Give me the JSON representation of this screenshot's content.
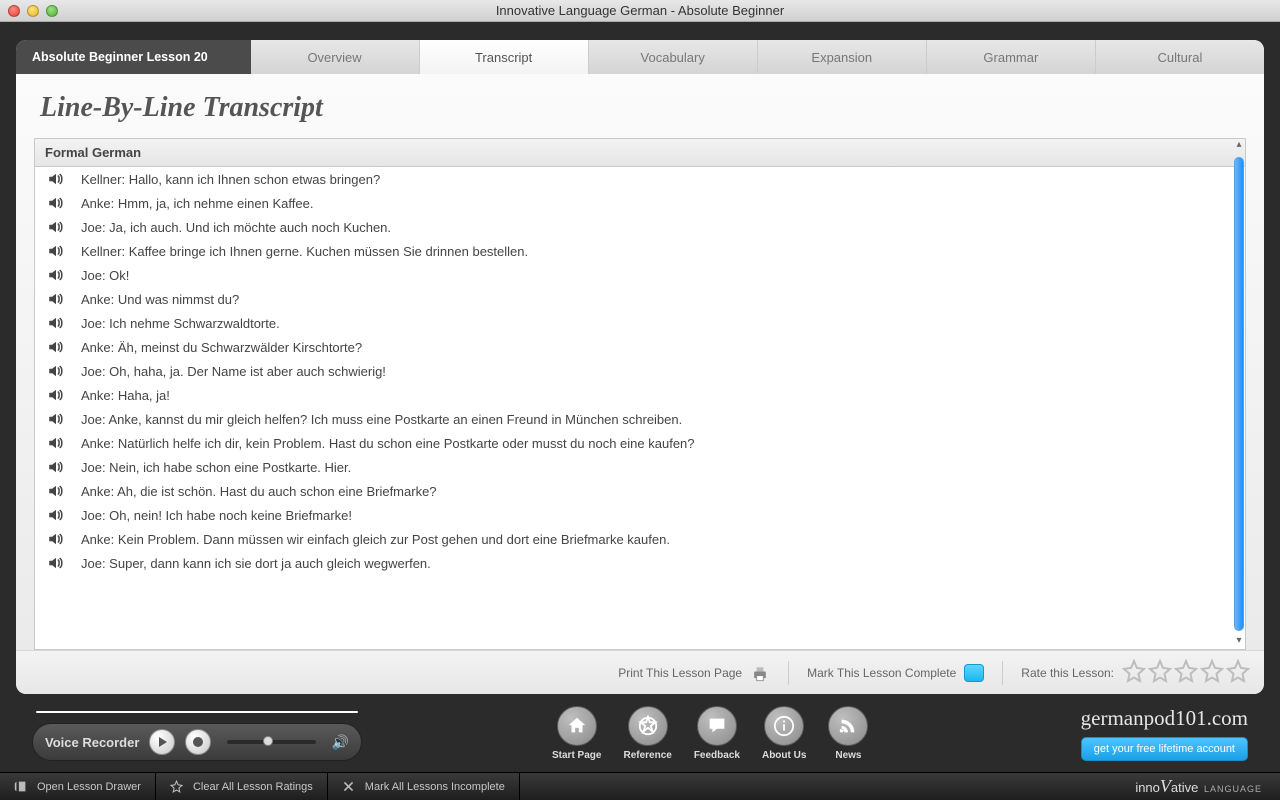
{
  "window": {
    "title": "Innovative Language German - Absolute Beginner"
  },
  "tabs": {
    "lesson": "Absolute Beginner Lesson 20",
    "items": [
      "Overview",
      "Transcript",
      "Vocabulary",
      "Expansion",
      "Grammar",
      "Cultural"
    ],
    "active_index": 1
  },
  "heading": "Line-By-Line Transcript",
  "transcript": {
    "section_title": "Formal German",
    "lines": [
      "Kellner: Hallo, kann ich Ihnen schon etwas bringen?",
      "Anke: Hmm, ja, ich nehme einen Kaffee.",
      "Joe: Ja, ich auch. Und ich möchte auch noch Kuchen.",
      "Kellner: Kaffee bringe ich Ihnen gerne. Kuchen müssen Sie drinnen bestellen.",
      "Joe: Ok!",
      "Anke: Und was nimmst du?",
      "Joe: Ich nehme Schwarzwaldtorte.",
      "Anke: Äh, meinst du Schwarzwälder Kirschtorte?",
      "Joe: Oh, haha, ja. Der Name ist aber auch schwierig!",
      "Anke: Haha, ja!",
      "Joe: Anke, kannst du mir gleich helfen? Ich muss eine Postkarte an einen Freund in München schreiben.",
      "Anke: Natürlich helfe ich dir, kein Problem. Hast du schon eine Postkarte oder musst du noch eine kaufen?",
      "Joe: Nein, ich habe schon eine Postkarte. Hier.",
      "Anke: Ah, die ist schön. Hast du auch schon eine Briefmarke?",
      "Joe: Oh, nein! Ich habe noch keine Briefmarke!",
      "Anke: Kein Problem. Dann müssen wir einfach gleich zur Post gehen und dort eine Briefmarke kaufen.",
      "Joe: Super, dann kann ich sie dort ja auch gleich wegwerfen."
    ]
  },
  "card_footer": {
    "print": "Print This Lesson Page",
    "mark_complete": "Mark This Lesson Complete",
    "rate_label": "Rate this Lesson:"
  },
  "recorder": {
    "label": "Voice Recorder"
  },
  "nav": [
    {
      "key": "start",
      "label": "Start Page"
    },
    {
      "key": "reference",
      "label": "Reference"
    },
    {
      "key": "feedback",
      "label": "Feedback"
    },
    {
      "key": "about",
      "label": "About Us"
    },
    {
      "key": "news",
      "label": "News"
    }
  ],
  "promo": {
    "domain": "germanpod101.com",
    "cta": "get your free lifetime account"
  },
  "status": {
    "open_drawer": "Open Lesson Drawer",
    "clear_ratings": "Clear All Lesson Ratings",
    "mark_incomplete": "Mark All Lessons Incomplete"
  },
  "brand": {
    "prefix": "inno",
    "v": "V",
    "suffix": "ative",
    "sub": "LANGUAGE"
  }
}
